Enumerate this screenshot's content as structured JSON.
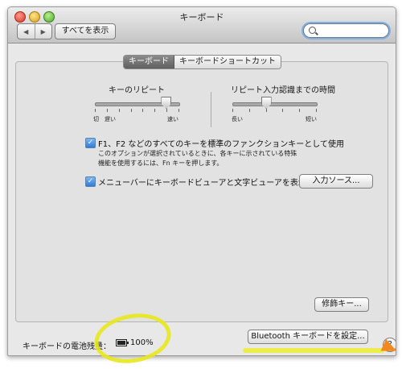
{
  "window": {
    "title": "キーボード",
    "nav": {
      "back_label": "◀",
      "forward_label": "▶"
    },
    "show_all_label": "すべてを表示",
    "search": {
      "placeholder": "",
      "value": ""
    }
  },
  "tabs": [
    {
      "label": "キーボード",
      "active": true
    },
    {
      "label": "キーボードショートカット",
      "active": false
    }
  ],
  "key_repeat": {
    "title": "キーのリピート",
    "left_label_1": "切",
    "left_label_2": "遅い",
    "right_label": "速い",
    "value_fraction": 0.85
  },
  "delay_until_repeat": {
    "title": "リピート入力認識までの時間",
    "left_label": "長い",
    "right_label": "短い",
    "value_fraction": 0.4
  },
  "fn_keys": {
    "checked": true,
    "label": "F1、F2 などのすべてのキーを標準のファンクションキーとして使用",
    "note_line_1": "このオプションが選択されているときに、各キーに示されている特殊",
    "note_line_2": "機能を使用するには、Fn キーを押します。"
  },
  "menu_bar_viewer": {
    "checked": true,
    "label": "メニューバーにキーボードビューアと文字ビューアを表示"
  },
  "input_sources_button": "入力ソース...",
  "modifier_keys_button": "修飾キー...",
  "battery": {
    "label": "キーボードの電池残量：",
    "percent_text": "100%",
    "level": 1.0
  },
  "bluetooth_button": "Bluetooth キーボードを設定...",
  "help_label": "?",
  "colors": {
    "highlight": "#e8e81f",
    "arrow": "#f08a1c",
    "checkbox": "#2d7fd8"
  }
}
